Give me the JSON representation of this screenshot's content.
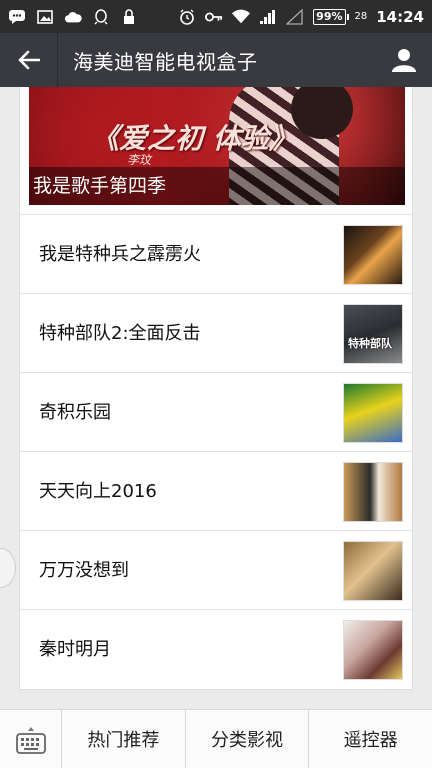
{
  "status_bar": {
    "battery": "99%",
    "signal_small": "28",
    "time": "14:24",
    "icons": [
      "chat-icon",
      "image-icon",
      "cloud-icon",
      "qq-icon",
      "lock-icon",
      "alarm-icon",
      "key-icon",
      "wifi-icon",
      "signal-icon",
      "signal-empty-icon",
      "battery-icon"
    ]
  },
  "header": {
    "title": "海美迪智能电视盒子",
    "back_icon": "arrow-left-icon",
    "profile_icon": "person-icon"
  },
  "banner": {
    "caption": "我是歌手第四季",
    "art_title": "《爱之初 体验》",
    "art_subtitle": "李玟"
  },
  "list": [
    {
      "title": "我是特种兵之霹雳火"
    },
    {
      "title": "特种部队2:全面反击",
      "thumb_text": "特种部队"
    },
    {
      "title": "奇积乐园"
    },
    {
      "title": "天天向上2016"
    },
    {
      "title": "万万没想到"
    },
    {
      "title": "秦时明月"
    }
  ],
  "bottom_menu": {
    "keyboard_icon": "keyboard-icon",
    "items": [
      "热门推荐",
      "分类影视",
      "遥控器"
    ]
  },
  "colors": {
    "status_bar": "#2d2d2d",
    "title_bar": "#393a3f",
    "page_bg": "#ebebeb"
  }
}
